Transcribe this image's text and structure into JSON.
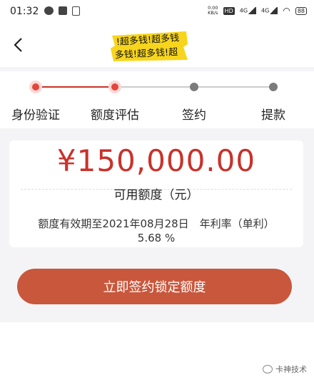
{
  "status_bar": {
    "time": "01:32",
    "net_speed": "0.00\nKB/s",
    "hd_badge": "HD",
    "signal_1": "4G",
    "signal_2": "4G",
    "battery": "88"
  },
  "header": {
    "logo_line_1": "!超多钱!超多钱",
    "logo_line_2": "多钱!超多钱!超"
  },
  "steps": [
    {
      "label": "身份验证",
      "state": "done"
    },
    {
      "label": "额度评估",
      "state": "current"
    },
    {
      "label": "签约",
      "state": "pending"
    },
    {
      "label": "提款",
      "state": "pending"
    }
  ],
  "credit": {
    "amount": "¥150,000.00",
    "amount_label": "可用额度（元）",
    "expiry_text": "额度有效期至2021年08月28日　年利率（单利）",
    "annual_rate": "5.68 %"
  },
  "actions": {
    "sign_button": "立即签约锁定额度"
  },
  "watermark": {
    "text": "卡神技术"
  },
  "colors": {
    "accent_red": "#c9322b",
    "button": "#c8573c",
    "background": "#f4f4f6"
  }
}
